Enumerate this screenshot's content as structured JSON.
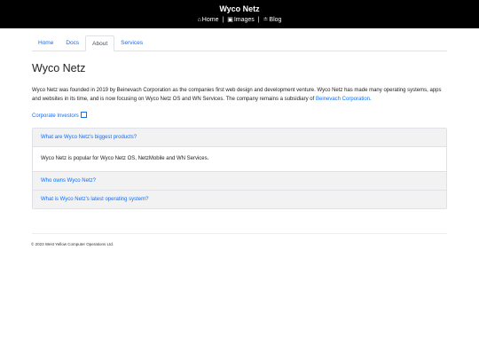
{
  "header": {
    "brand": "Wyco Netz",
    "nav": [
      {
        "label": "Home",
        "icon": "home-icon"
      },
      {
        "label": "Images",
        "icon": "images-icon"
      },
      {
        "label": "Blog",
        "icon": "rss-icon"
      }
    ],
    "separator": "|"
  },
  "tabs": [
    {
      "label": "Home"
    },
    {
      "label": "Docs"
    },
    {
      "label": "About",
      "active": true
    },
    {
      "label": "Services"
    }
  ],
  "main": {
    "title": "Wyco Netz",
    "paragraph_text": "Wyco Netz was founded in 2019 by Beinevach Corporation as the companies first web design and development venture. Wyco Netz has made many operating systems, apps and websites in its time, and is now focusing on Wyco Netz OS and WN Services. The company remains a subsidiary of ",
    "paragraph_link": "Beinevach Corporation",
    "paragraph_end": ".",
    "investors_link": "Corporate Investors"
  },
  "accordion": [
    {
      "question": "What are Wyco Netz's biggest products?",
      "answer": "Wyco Netz is popular for Wyco Netz OS, NetzMobile and WN Services.",
      "expanded": true
    },
    {
      "question": "Who owns Wyco Netz?",
      "expanded": false
    },
    {
      "question": "What is Wyco Netz's latest operating system?",
      "expanded": false
    }
  ],
  "footer": {
    "text": "© 2023 West Yellow Computer Operations Ltd."
  },
  "colors": {
    "accent": "#0d6efd",
    "topbar": "#000000",
    "accordion_header": "#f2f2f2"
  }
}
